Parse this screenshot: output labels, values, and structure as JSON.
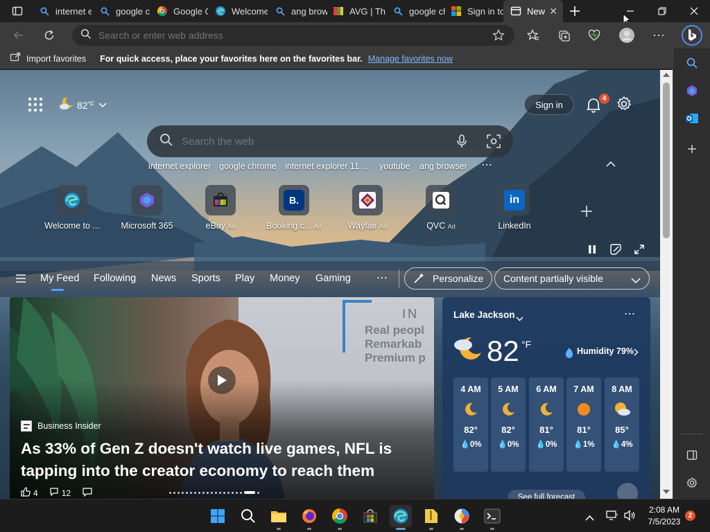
{
  "tabs": [
    {
      "title": "internet explorer",
      "icon": "search-icon"
    },
    {
      "title": "google chrome",
      "icon": "search-icon"
    },
    {
      "title": "Google Chrome",
      "icon": "chrome-icon"
    },
    {
      "title": "Welcome to Microsoft Edge",
      "icon": "edge-icon"
    },
    {
      "title": "ang browser",
      "icon": "search-icon"
    },
    {
      "title": "AVG | The",
      "icon": "avg-icon"
    },
    {
      "title": "google chrome",
      "icon": "search-icon"
    },
    {
      "title": "Sign in to",
      "icon": "microsoft-icon"
    },
    {
      "title": "New",
      "icon": "newtab-icon",
      "active": true
    }
  ],
  "address": {
    "placeholder": "Search or enter web address"
  },
  "favbar": {
    "import_label": "Import favorites",
    "message": "For quick access, place your favorites here on the favorites bar.",
    "link": "Manage favorites now"
  },
  "header": {
    "temp": "82",
    "unit": "°F",
    "sign_in": "Sign in",
    "notifications": "4"
  },
  "search": {
    "placeholder": "Search the web",
    "suggestions": [
      "internet explorer",
      "google chrome",
      "internet explorer 11 ...",
      "youtube",
      "ang browser"
    ]
  },
  "tiles": [
    {
      "label": "Welcome to ...",
      "ad": "",
      "glyph": "e",
      "color": "#1b8fd6"
    },
    {
      "label": "Microsoft 365",
      "ad": "",
      "glyph": "◆",
      "color": "#8a63d2"
    },
    {
      "label": "eBay",
      "ad": "Ad",
      "glyph": "▤",
      "color": "#e53238"
    },
    {
      "label": "Booking.c...",
      "ad": "Ad",
      "glyph": "B.",
      "color": "#003580"
    },
    {
      "label": "Wayfair",
      "ad": "Ad",
      "glyph": "❖",
      "color": "#7b189f"
    },
    {
      "label": "QVC",
      "ad": "Ad",
      "glyph": "Q",
      "color": "#ffffff"
    },
    {
      "label": "LinkedIn",
      "ad": "",
      "glyph": "in",
      "color": "#0a66c2"
    }
  ],
  "feednav": {
    "items": [
      "My Feed",
      "Following",
      "News",
      "Sports",
      "Play",
      "Money",
      "Gaming"
    ],
    "personalize": "Personalize",
    "content": "Content partially visible"
  },
  "article": {
    "source": "Business Insider",
    "headline_line1": "As 33% of Gen Z doesn't watch live games, NFL is",
    "headline_line2": "tapping into the creator economy to reach them",
    "likes": "4",
    "comments": "12",
    "bg_text_1": "Real peopl",
    "bg_text_2": "Remarkab",
    "bg_text_3": "Premium p",
    "bg_text_4": "IN"
  },
  "weather": {
    "location": "Lake Jackson",
    "temp": "82",
    "unit": "°F",
    "humidity": "Humidity 79%",
    "hours": [
      {
        "time": "4 AM",
        "icon": "moon-icon",
        "temp": "82°",
        "precip": "0%"
      },
      {
        "time": "5 AM",
        "icon": "moon-icon",
        "temp": "82°",
        "precip": "0%"
      },
      {
        "time": "6 AM",
        "icon": "moon-icon",
        "temp": "81°",
        "precip": "0%"
      },
      {
        "time": "7 AM",
        "icon": "sun-icon",
        "temp": "81°",
        "precip": "1%"
      },
      {
        "time": "8 AM",
        "icon": "partly-cloudy-icon",
        "temp": "85°",
        "precip": "4%"
      }
    ],
    "forecast_link": "See full forecast"
  },
  "taskbar": {
    "time": "2:08 AM",
    "date": "7/5/2023",
    "badge": "2"
  }
}
